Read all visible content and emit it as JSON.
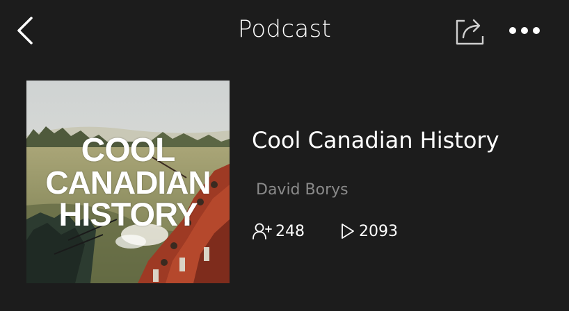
{
  "header": {
    "title": "Podcast",
    "back_icon": "chevron-left-icon",
    "share_icon": "share-icon",
    "more_icon": "more-horizontal-icon"
  },
  "cover": {
    "line1": "COOL",
    "line2": "CANADIAN",
    "line3": "HISTORY"
  },
  "podcast": {
    "title": "Cool Canadian History",
    "author": "David Borys",
    "subscribers": "248",
    "plays": "2093"
  },
  "colors": {
    "background": "#1c1c1c",
    "text_primary": "#ffffff",
    "text_secondary": "#8a8a8a"
  }
}
